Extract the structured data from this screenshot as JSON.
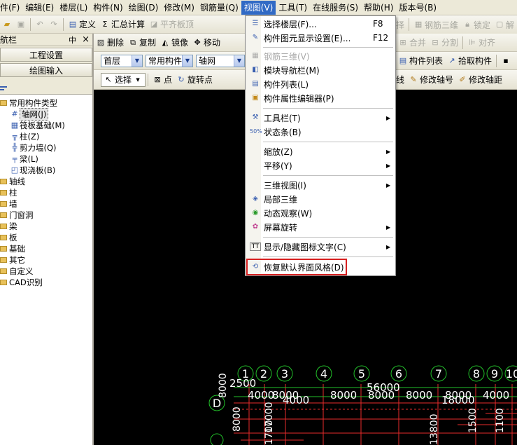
{
  "menubar": [
    "件(F)",
    "编辑(E)",
    "楼层(L)",
    "构件(N)",
    "绘图(D)",
    "修改(M)",
    "钢筋量(Q)",
    "视图(V)",
    "工具(T)",
    "在线服务(S)",
    "帮助(H)",
    "版本号(B)"
  ],
  "toolbar1": {
    "define": "定义",
    "sum": "汇总计算",
    "flat": "平齐板顶",
    "right": {
      "select": "择",
      "rebar3d": "钢筋三维",
      "lock": "锁定",
      "unlock": "解"
    }
  },
  "toolbar2": {
    "delete": "删除",
    "copy": "复制",
    "mirror": "镜像",
    "move": "移动",
    "right": {
      "merge": "合并",
      "split": "分割",
      "align": "对齐"
    }
  },
  "toolbar3": {
    "floor": "首层",
    "type": "常用构件",
    "item": "轴网",
    "right": {
      "list": "构件列表",
      "pick": "拾取构件"
    }
  },
  "toolbar4": {
    "select": "选择",
    "point": "点",
    "rotate": "旋转点",
    "right": {
      "line": "线",
      "modify_axis": "修改轴号",
      "modify_dist": "修改轴距"
    }
  },
  "leftpanel": {
    "title": "导航栏",
    "pin": "中",
    "close": "×",
    "btn_project": "工程设置",
    "btn_draw": "绘图输入",
    "tree_root": "常用构件类型",
    "tree_children": [
      "轴网(J)",
      "筏板基础(M)",
      "柱(Z)",
      "剪力墙(Q)",
      "梁(L)",
      "现浇板(B)"
    ],
    "tree_groups": [
      "轴线",
      "柱",
      "墙",
      "门窗洞",
      "梁",
      "板",
      "基础",
      "其它",
      "自定义",
      "CAD识别"
    ]
  },
  "view_menu": {
    "items": [
      {
        "label": "选择楼层(F)...",
        "key": "F8",
        "icon": "layers-icon"
      },
      {
        "label": "构件图元显示设置(E)...",
        "key": "F12",
        "icon": "display-settings-icon"
      },
      {
        "label": "钢筋三维(V)",
        "icon": "rebar-3d-icon",
        "disabled": true
      },
      {
        "label": "模块导航栏(M)",
        "icon": "nav-panel-icon"
      },
      {
        "label": "构件列表(L)",
        "icon": "list-icon"
      },
      {
        "label": "构件属性编辑器(P)",
        "icon": "property-editor-icon"
      },
      {
        "label": "工具栏(T)",
        "icon": "toolbar-icon",
        "submenu": true
      },
      {
        "label": "状态条(B)",
        "icon": "statusbar-icon"
      },
      {
        "label": "缩放(Z)",
        "submenu": true
      },
      {
        "label": "平移(Y)",
        "submenu": true
      },
      {
        "label": "三维视图(I)",
        "submenu": true
      },
      {
        "label": "局部三维",
        "icon": "local-3d-icon"
      },
      {
        "label": "动态观察(W)",
        "icon": "orbit-icon"
      },
      {
        "label": "屏幕旋转",
        "icon": "screen-rotate-icon",
        "submenu": true
      },
      {
        "label": "显示/隐藏图标文字(C)",
        "icon": "text-toggle-icon",
        "submenu": true
      },
      {
        "label": "恢复默认界面风格(D)",
        "icon": "restore-layout-icon"
      }
    ]
  },
  "canvas": {
    "axis_numbers": [
      "1",
      "2",
      "3",
      "4",
      "5",
      "6",
      "7",
      "8",
      "9",
      "10"
    ],
    "dims_top": [
      "2500",
      "56000"
    ],
    "dims_row": [
      "4000",
      "8000",
      "8000",
      "8000",
      "8000",
      "8000",
      "4000"
    ],
    "dims_misc": [
      "4000",
      "18000",
      "8000",
      "1500",
      "1100",
      "17000",
      "1700",
      "8000",
      "13800"
    ],
    "row_label": "D"
  },
  "colors": {
    "menu_highlight": "#316ac5",
    "highlight_box": "#d72020",
    "grid_green": "#22c02a",
    "grid_red": "#e82b2b"
  }
}
